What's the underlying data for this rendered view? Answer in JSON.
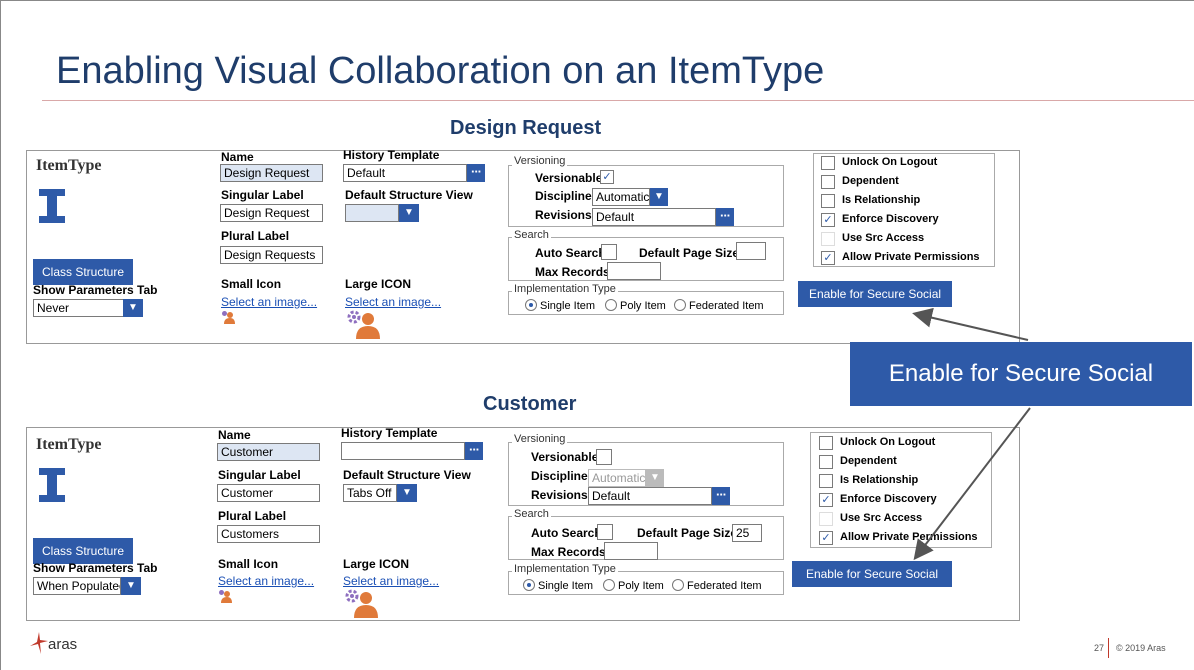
{
  "title": "Enabling Visual Collaboration on an ItemType",
  "callout": "Enable for Secure Social",
  "footer": {
    "logo": "aras",
    "page": "27",
    "copyright": "© 2019 Aras"
  },
  "icons": {
    "itemtype": "itemtype-i-icon",
    "small": "small-user-icon",
    "large": "large-user-gear-icon",
    "arrow": "arrow-icon"
  },
  "colors": {
    "primary": "#2e5aa8",
    "title": "#1f3d6b",
    "accent": "#c0392b"
  },
  "panels": [
    {
      "heading": "Design Request",
      "itemtype_label": "ItemType",
      "class_structure_button": "Class Structure",
      "show_params_label": "Show Parameters Tab",
      "show_params_value": "Never",
      "name_label": "Name",
      "name_value": "Design Request",
      "singular_label": "Singular Label",
      "singular_value": "Design Request",
      "plural_label": "Plural Label",
      "plural_value": "Design Requests",
      "small_icon_label": "Small Icon",
      "small_icon_link": "Select an image...",
      "history_label": "History Template",
      "history_value": "Default",
      "structure_label": "Default Structure View",
      "structure_value": "",
      "large_icon_label": "Large ICON",
      "large_icon_link": "Select an image...",
      "versioning_legend": "Versioning",
      "versionable_label": "Versionable",
      "versionable_checked": true,
      "discipline_label": "Discipline",
      "discipline_value": "Automatic",
      "revisions_label": "Revisions",
      "revisions_value": "Default",
      "search_legend": "Search",
      "auto_search_label": "Auto Search",
      "default_page_size_label": "Default Page Size",
      "default_page_size_value": "",
      "max_records_label": "Max Records",
      "max_records_value": "",
      "impl_legend": "Implementation Type",
      "impl_options": [
        "Single Item",
        "Poly Item",
        "Federated Item"
      ],
      "impl_selected": 0,
      "checks": [
        {
          "label": "Unlock On Logout",
          "checked": false
        },
        {
          "label": "Dependent",
          "checked": false
        },
        {
          "label": "Is Relationship",
          "checked": false
        },
        {
          "label": "Enforce Discovery",
          "checked": true
        },
        {
          "label": "Use Src Access",
          "checked": false
        },
        {
          "label": "Allow Private Permissions",
          "checked": true
        }
      ],
      "secure_social_button": "Enable for Secure Social"
    },
    {
      "heading": "Customer",
      "itemtype_label": "ItemType",
      "class_structure_button": "Class Structure",
      "show_params_label": "Show Parameters Tab",
      "show_params_value": "When Populatec",
      "name_label": "Name",
      "name_value": "Customer",
      "singular_label": "Singular Label",
      "singular_value": "Customer",
      "plural_label": "Plural Label",
      "plural_value": "Customers",
      "small_icon_label": "Small Icon",
      "small_icon_link": "Select an image...",
      "history_label": "History Template",
      "history_value": "",
      "structure_label": "Default Structure View",
      "structure_value": "Tabs Off",
      "large_icon_label": "Large ICON",
      "large_icon_link": "Select an image...",
      "versioning_legend": "Versioning",
      "versionable_label": "Versionable",
      "versionable_checked": false,
      "discipline_label": "Discipline",
      "discipline_value": "Automatic",
      "revisions_label": "Revisions",
      "revisions_value": "Default",
      "search_legend": "Search",
      "auto_search_label": "Auto Search",
      "default_page_size_label": "Default Page Size",
      "default_page_size_value": "25",
      "max_records_label": "Max Records",
      "max_records_value": "",
      "impl_legend": "Implementation Type",
      "impl_options": [
        "Single Item",
        "Poly Item",
        "Federated Item"
      ],
      "impl_selected": 0,
      "checks": [
        {
          "label": "Unlock On Logout",
          "checked": false
        },
        {
          "label": "Dependent",
          "checked": false
        },
        {
          "label": "Is Relationship",
          "checked": false
        },
        {
          "label": "Enforce Discovery",
          "checked": true
        },
        {
          "label": "Use Src Access",
          "checked": false
        },
        {
          "label": "Allow Private Permissions",
          "checked": true
        }
      ],
      "secure_social_button": "Enable for Secure Social"
    }
  ]
}
